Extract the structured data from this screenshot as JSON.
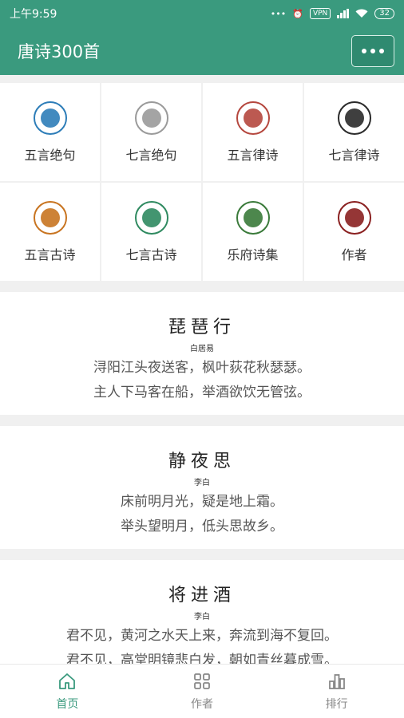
{
  "status": {
    "time": "上午9:59",
    "vpn": "VPN",
    "battery": "32"
  },
  "app": {
    "title": "唐诗300首"
  },
  "categories": [
    {
      "label": "五言绝句",
      "icon": "calligraphy-seal-icon",
      "color": "#2d7db8"
    },
    {
      "label": "七言绝句",
      "icon": "brush-seal-icon",
      "color": "#9a9a9a"
    },
    {
      "label": "五言律诗",
      "icon": "lotus-seal-icon",
      "color": "#b5473e"
    },
    {
      "label": "七言律诗",
      "icon": "dragon-seal-icon",
      "color": "#2a2a2a"
    },
    {
      "label": "五言古诗",
      "icon": "horse-seal-icon",
      "color": "#c87420"
    },
    {
      "label": "七言古诗",
      "icon": "chariot-seal-icon",
      "color": "#2f8a60"
    },
    {
      "label": "乐府诗集",
      "icon": "book-seal-icon",
      "color": "#3a7a3a"
    },
    {
      "label": "作者",
      "icon": "portrait-seal-icon",
      "color": "#8a2020"
    }
  ],
  "poems": [
    {
      "title": "琵琶行",
      "author": "白居易",
      "line1": "浔阳江头夜送客，枫叶荻花秋瑟瑟。",
      "line2": "主人下马客在船，举酒欲饮无管弦。"
    },
    {
      "title": "静夜思",
      "author": "李白",
      "line1": "床前明月光，疑是地上霜。",
      "line2": "举头望明月，低头思故乡。"
    },
    {
      "title": "将进酒",
      "author": "李白",
      "line1": "君不见，黄河之水天上来，奔流到海不复回。",
      "line2": "君不见，高堂明镜悲白发，朝如青丝暮成雪。"
    }
  ],
  "tabs": [
    {
      "label": "首页",
      "icon": "home-icon",
      "active": true
    },
    {
      "label": "作者",
      "icon": "grid-icon",
      "active": false
    },
    {
      "label": "排行",
      "icon": "bar-chart-icon",
      "active": false
    }
  ],
  "colors": {
    "primary": "#3a9a7e"
  }
}
